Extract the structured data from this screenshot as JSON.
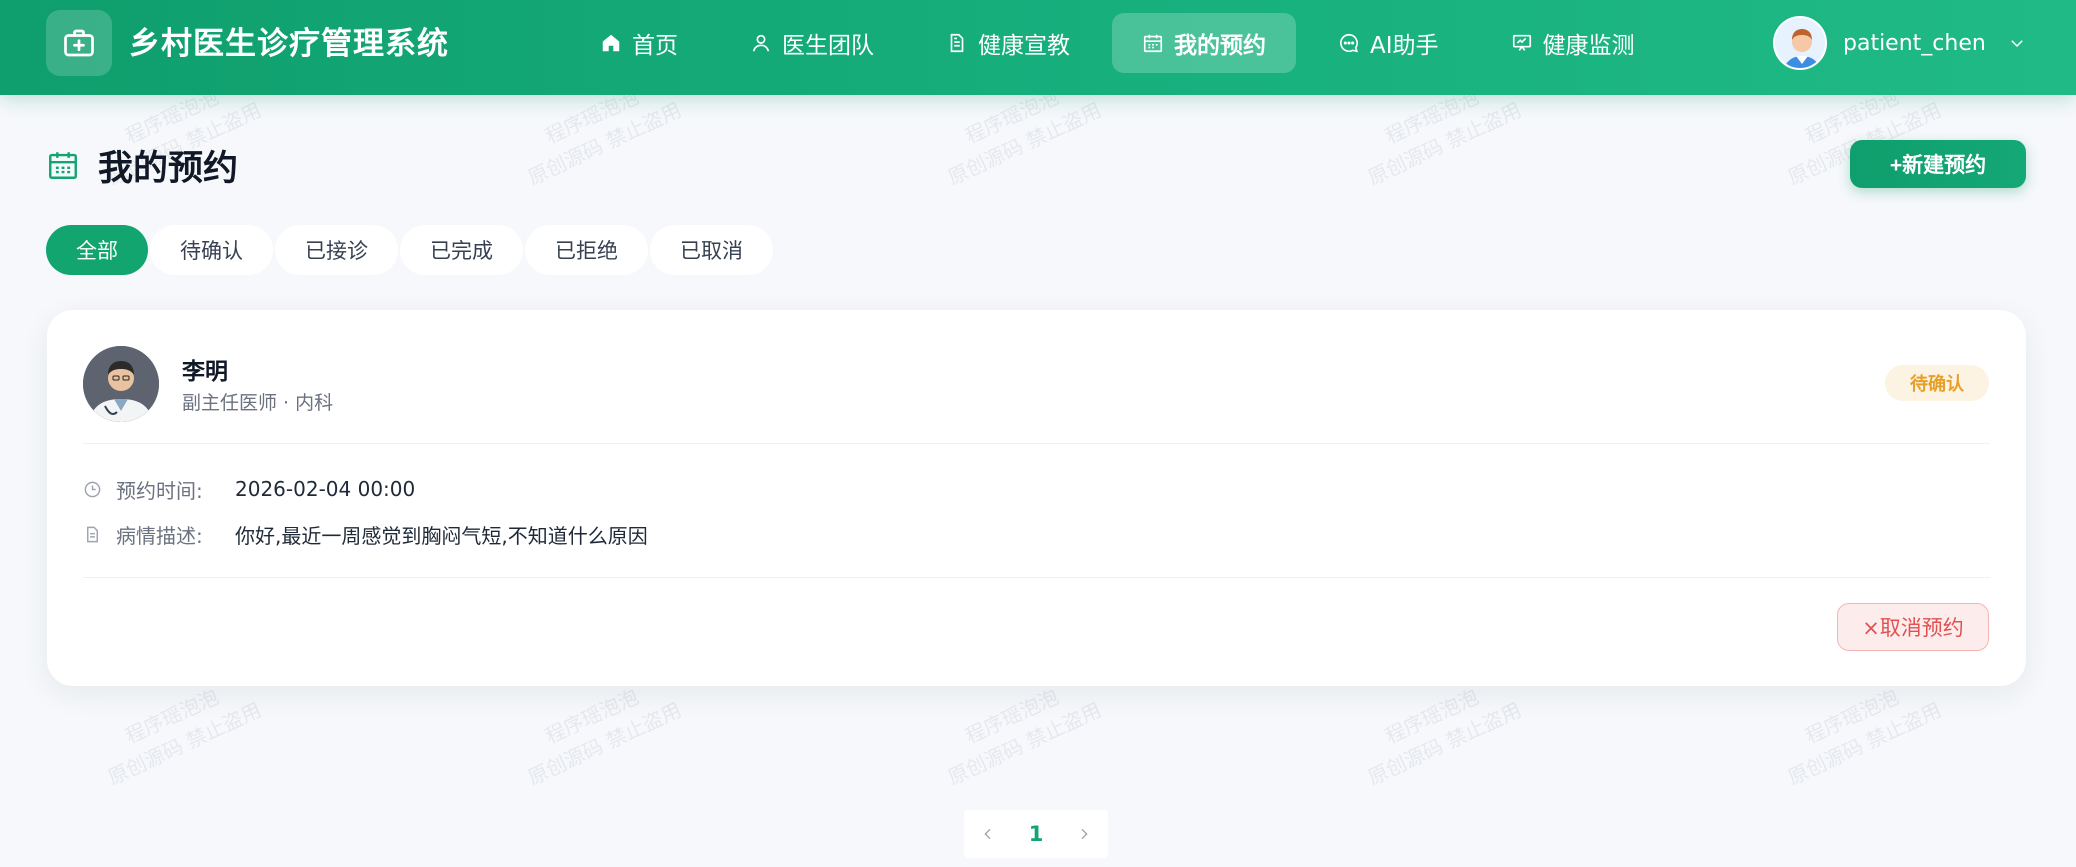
{
  "app": {
    "title": "乡村医生诊疗管理系统"
  },
  "nav": [
    {
      "label": "首页",
      "icon": "home-icon",
      "active": false
    },
    {
      "label": "医生团队",
      "icon": "user-icon",
      "active": false
    },
    {
      "label": "健康宣教",
      "icon": "document-icon",
      "active": false
    },
    {
      "label": "我的预约",
      "icon": "calendar-icon",
      "active": true
    },
    {
      "label": "AI助手",
      "icon": "chat-icon",
      "active": false
    },
    {
      "label": "健康监测",
      "icon": "monitor-icon",
      "active": false
    }
  ],
  "user": {
    "name": "patient_chen"
  },
  "page": {
    "title": "我的预约",
    "new_button": "+新建预约"
  },
  "tabs": [
    {
      "label": "全部",
      "active": true
    },
    {
      "label": "待确认",
      "active": false
    },
    {
      "label": "已接诊",
      "active": false
    },
    {
      "label": "已完成",
      "active": false
    },
    {
      "label": "已拒绝",
      "active": false
    },
    {
      "label": "已取消",
      "active": false
    }
  ],
  "appointment": {
    "doctor_name": "李明",
    "doctor_title": "副主任医师 · 内科",
    "status": "待确认",
    "time_label": "预约时间:",
    "time_value": "2026-02-04 00:00",
    "desc_label": "病情描述:",
    "desc_value": "你好,最近一周感觉到胸闷气短,不知道什么原因",
    "cancel_button": "×取消预约"
  },
  "pagination": {
    "current": "1"
  },
  "watermark": {
    "line1": "程序瑶泡泡",
    "line2": "原创源码 禁止盗用"
  },
  "colors": {
    "primary": "#12a570",
    "pending": "#e6a02a",
    "danger": "#e05252"
  }
}
